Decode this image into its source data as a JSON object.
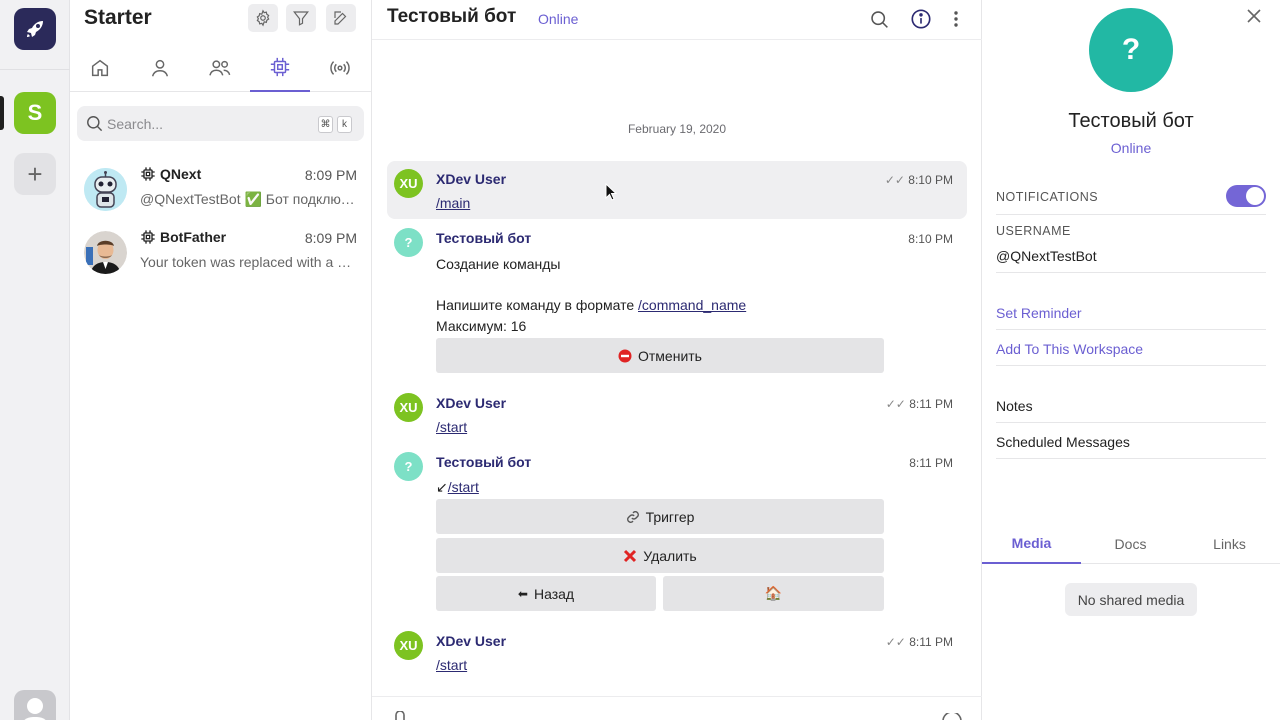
{
  "workspace": {
    "name": "Starter",
    "initial": "S",
    "add_label": "+"
  },
  "chat_list": {
    "search_placeholder": "Search...",
    "shortcut_keys": [
      "⌘",
      "k"
    ],
    "conversations": [
      {
        "name": "QNext",
        "time": "8:09 PM",
        "preview": "@QNextTestBot ✅ Бот подключен"
      },
      {
        "name": "BotFather",
        "time": "8:09 PM",
        "preview": "Your token was replaced with a new one"
      }
    ]
  },
  "chat": {
    "title": "Тестовый бот",
    "status": "Online",
    "date_separator": "February 19, 2020",
    "messages": [
      {
        "author": "XDev User",
        "initials": "XU",
        "time": "8:10 PM",
        "text": "/main"
      },
      {
        "author": "Тестовый бот",
        "initials": "?",
        "time": "8:10 PM",
        "line1": "Создание команды",
        "line2_prefix": "Напишите команду в формате ",
        "line2_cmd": "/command_name",
        "line3": "Максимум: 16",
        "button": "Отменить"
      },
      {
        "author": "XDev User",
        "initials": "XU",
        "time": "8:11 PM",
        "text": "/start"
      },
      {
        "author": "Тестовый бот",
        "initials": "?",
        "time": "8:11 PM",
        "prefix": "↙",
        "text": "/start",
        "buttons": [
          "Триггер",
          "Удалить",
          "Назад",
          "🏠"
        ]
      },
      {
        "author": "XDev User",
        "initials": "XU",
        "time": "8:11 PM",
        "text": "/start"
      }
    ]
  },
  "info": {
    "avatar_initial": "?",
    "name": "Тестовый бот",
    "status": "Online",
    "notifications_label": "NOTIFICATIONS",
    "notifications_on": true,
    "username_label": "USERNAME",
    "username": "@QNextTestBot",
    "set_reminder": "Set Reminder",
    "add_to_workspace": "Add To This Workspace",
    "notes": "Notes",
    "scheduled": "Scheduled Messages",
    "tabs": [
      "Media",
      "Docs",
      "Links"
    ],
    "empty_media": "No shared media"
  },
  "colors": {
    "accent": "#6b5fd2",
    "workspace_green": "#7dc321",
    "bot_avatar": "#22b8a4",
    "author_name": "#2c2a72"
  }
}
